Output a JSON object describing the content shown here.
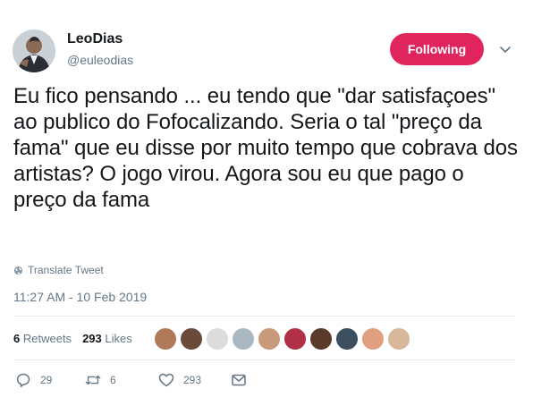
{
  "user": {
    "name": "LeoDias",
    "handle": "@euleodias",
    "follow_label": "Following"
  },
  "tweet": {
    "text": "Eu fico pensando ... eu tendo que \"dar satisfaçoes\" ao publico do Fofocalizando. Seria o tal \"preço da fama\" que eu disse por muito tempo que cobrava dos artistas? O jogo virou. Agora sou eu que pago o preço da fama",
    "translate_label": "Translate Tweet",
    "timestamp": "11:27 AM - 10 Feb 2019"
  },
  "stats": {
    "retweets_count": "6",
    "retweets_label": "Retweets",
    "likes_count": "293",
    "likes_label": "Likes"
  },
  "actions": {
    "reply_count": "29",
    "retweet_count": "6",
    "like_count": "293"
  },
  "colors": {
    "following_button": "#e0245e",
    "secondary_text": "#657786",
    "primary_text": "#14171a"
  },
  "icons": {
    "translate": "globe-icon",
    "reply": "reply-icon",
    "retweet": "retweet-icon",
    "like": "heart-icon",
    "dm": "envelope-icon",
    "menu": "chevron-down-icon"
  }
}
